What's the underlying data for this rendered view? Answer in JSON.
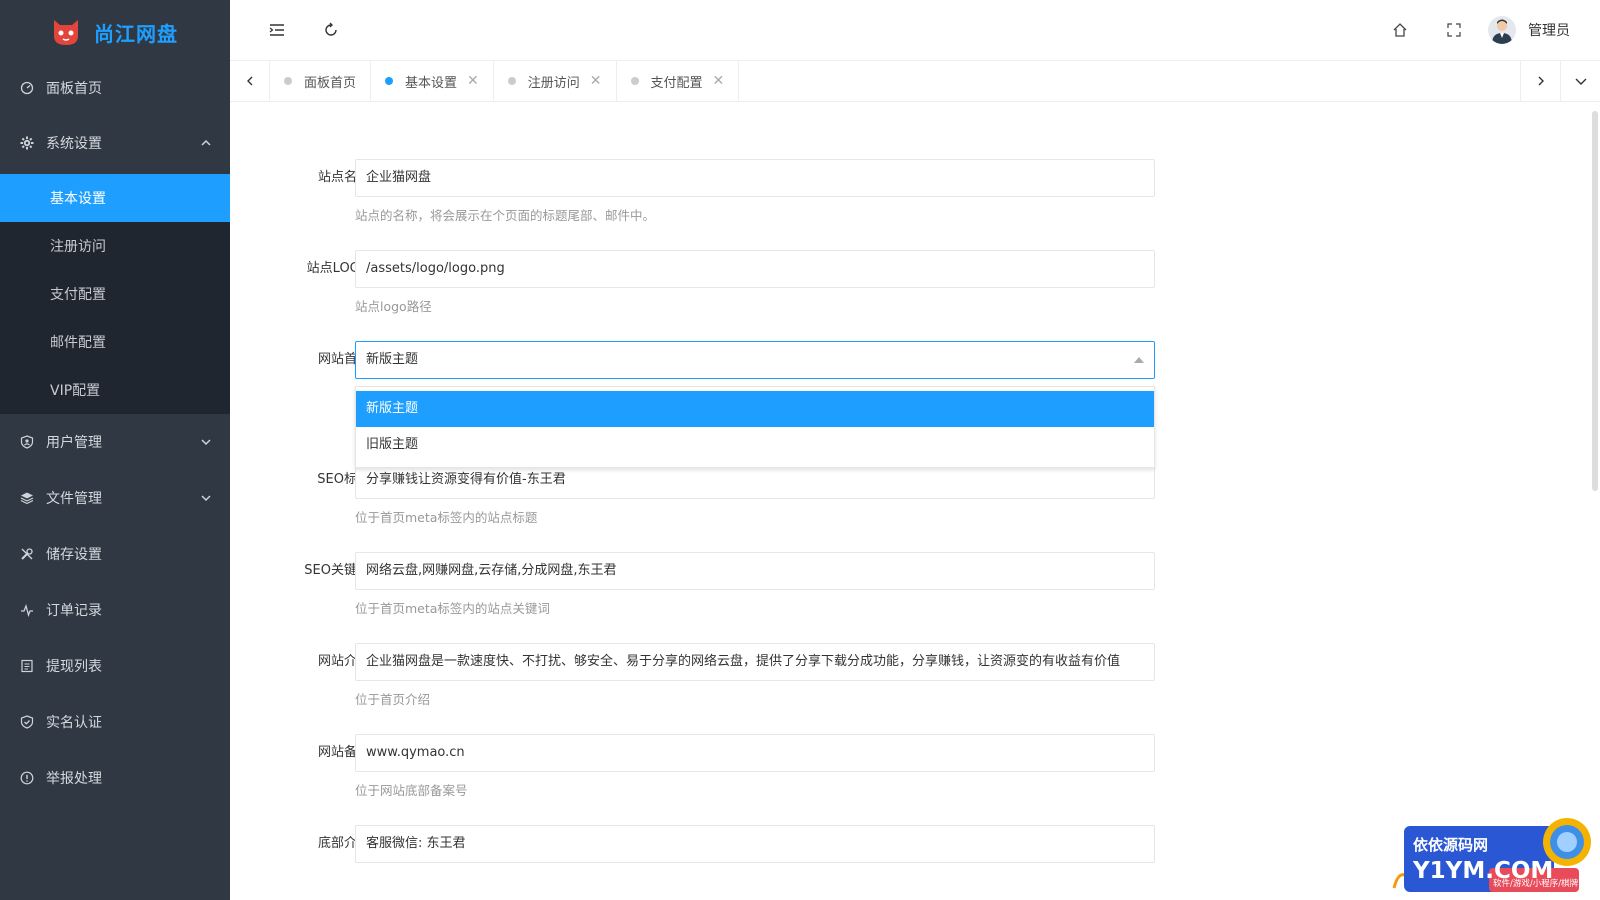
{
  "app": {
    "name": "尚江网盘"
  },
  "sidebar": {
    "items": [
      {
        "label": "面板首页",
        "icon": "dashboard-icon"
      },
      {
        "label": "系统设置",
        "icon": "gear-icon",
        "expanded": true,
        "children": [
          {
            "label": "基本设置",
            "active": true
          },
          {
            "label": "注册访问"
          },
          {
            "label": "支付配置"
          },
          {
            "label": "邮件配置"
          },
          {
            "label": "VIP配置"
          }
        ]
      },
      {
        "label": "用户管理",
        "icon": "user-shield-icon"
      },
      {
        "label": "文件管理",
        "icon": "layers-icon"
      },
      {
        "label": "储存设置",
        "icon": "tools-icon"
      },
      {
        "label": "订单记录",
        "icon": "pulse-icon"
      },
      {
        "label": "提现列表",
        "icon": "list-doc-icon"
      },
      {
        "label": "实名认证",
        "icon": "shield-check-icon"
      },
      {
        "label": "举报处理",
        "icon": "info-circle-icon"
      }
    ]
  },
  "header": {
    "admin_name": "管理员"
  },
  "tabs": [
    {
      "label": "面板首页",
      "closable": false,
      "active": false
    },
    {
      "label": "基本设置",
      "closable": true,
      "active": true
    },
    {
      "label": "注册访问",
      "closable": true,
      "active": false
    },
    {
      "label": "支付配置",
      "closable": true,
      "active": false
    }
  ],
  "form": {
    "site_name": {
      "label": "站点名称",
      "value": "企业猫网盘",
      "help": "站点的名称，将会展示在个页面的标题尾部、邮件中。"
    },
    "site_logo": {
      "label": "站点LOGO",
      "value": "/assets/logo/logo.png",
      "help": "站点logo路径"
    },
    "homepage": {
      "label": "网站首页",
      "value": "新版主题",
      "options": [
        "新版主题",
        "旧版主题"
      ]
    },
    "seo_title": {
      "label": "SEO标题",
      "value": "分享赚钱让资源变得有价值-东王君",
      "help": "位于首页meta标签内的站点标题"
    },
    "seo_keywords": {
      "label": "SEO关键词",
      "value": "网络云盘,网赚网盘,云存储,分成网盘,东王君",
      "help": "位于首页meta标签内的站点关键词"
    },
    "intro": {
      "label": "网站介绍",
      "value": "企业猫网盘是一款速度快、不打扰、够安全、易于分享的网络云盘，提供了分享下载分成功能，分享赚钱，让资源变的有收益有价值",
      "help": "位于首页介绍"
    },
    "icp": {
      "label": "网站备案",
      "value": "www.qymao.cn",
      "help": "位于网站底部备案号"
    },
    "footer": {
      "label": "底部介绍",
      "value": "客服微信: 东王君"
    }
  },
  "watermark": {
    "line1": "依依源码网",
    "line2": "Y1YM.COM",
    "line3": "软件/游戏/小程序/棋牌"
  },
  "colors": {
    "sidebar_bg": "#303844",
    "submenu_bg": "#20262f",
    "accent": "#1e9fff"
  }
}
